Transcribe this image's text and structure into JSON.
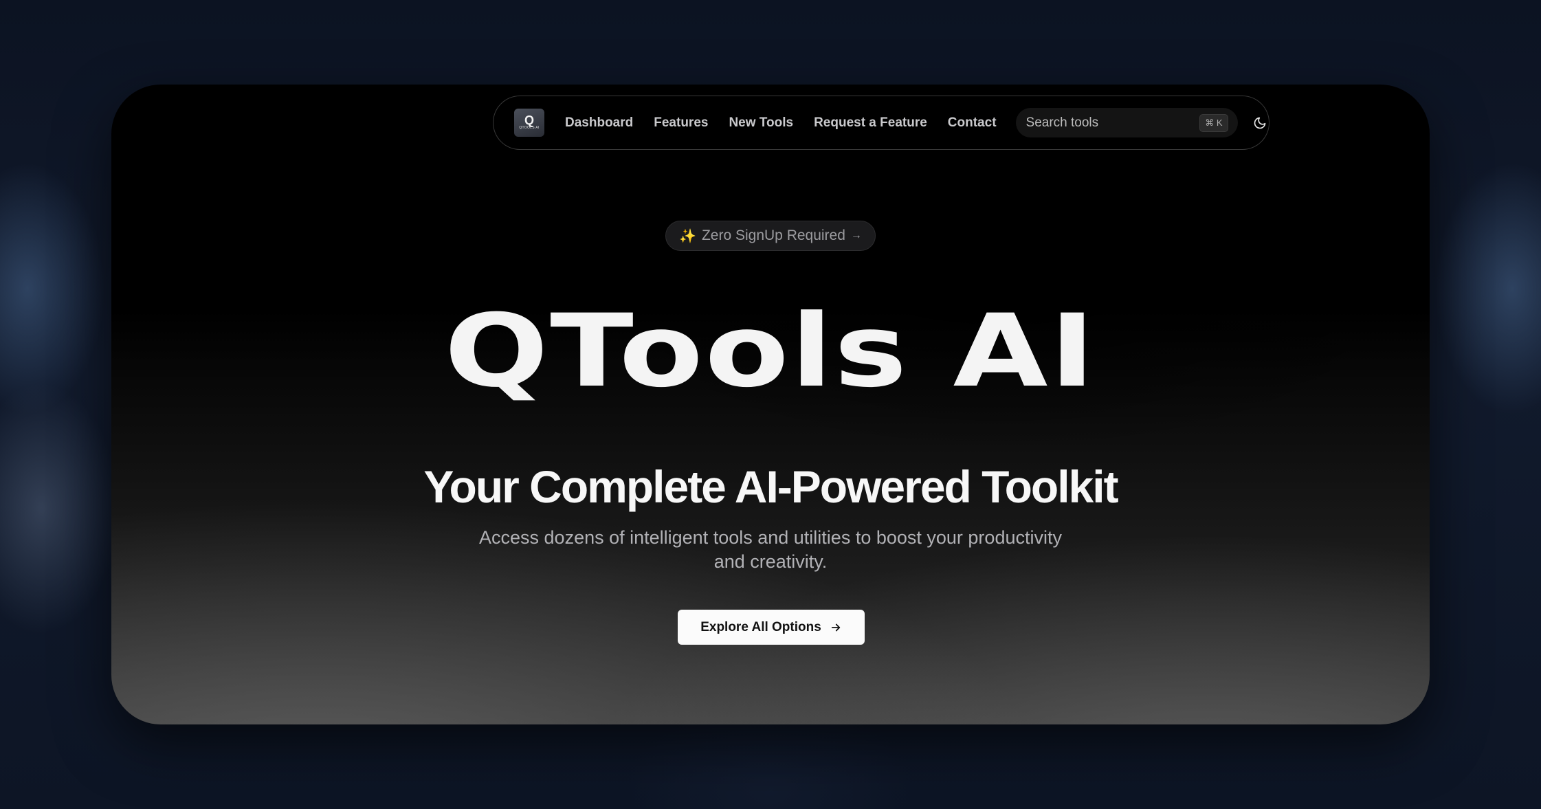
{
  "nav": {
    "logo_glyph": "Q",
    "logo_text": "QTOOLS AI",
    "links": [
      "Dashboard",
      "Features",
      "New Tools",
      "Request a Feature",
      "Contact"
    ],
    "search": {
      "placeholder": "Search tools",
      "shortcut": "⌘ K"
    },
    "theme_icon": "moon-icon"
  },
  "badge": {
    "icon": "sparkles-icon",
    "text": "Zero SignUp Required",
    "arrow": "→"
  },
  "hero": {
    "brand": "QTools AI",
    "tagline": "Your Complete AI-Powered Toolkit",
    "subtitle": "Access dozens of intelligent tools and utilities to boost your productivity and creativity.",
    "cta_label": "Explore All Options"
  },
  "colors": {
    "page_bg": "#0e1524",
    "card_bg": "#000000",
    "cta_bg": "#fbfbfb",
    "sparkle": "#f4c04e"
  }
}
